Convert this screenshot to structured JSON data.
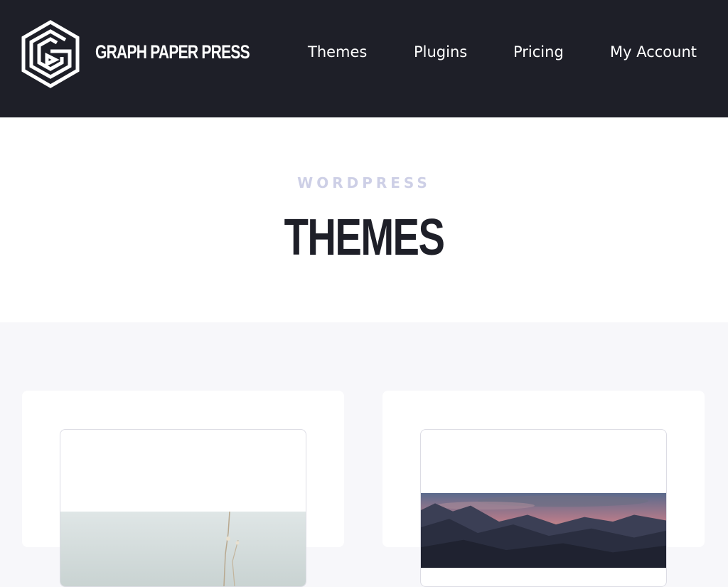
{
  "brand": {
    "name": "GRAPH PAPER PRESS",
    "logo_icon": "hexagon-maze-logo-icon"
  },
  "nav": {
    "items": [
      {
        "label": "Themes"
      },
      {
        "label": "Plugins"
      },
      {
        "label": "Pricing"
      },
      {
        "label": "My Account"
      }
    ]
  },
  "hero": {
    "eyebrow": "WORDPRESS",
    "title": "THEMES"
  },
  "colors": {
    "header_bg": "#1e1f28",
    "eyebrow": "#cdcfe6",
    "title": "#1e1f28",
    "section_bg": "#f7f7fa"
  },
  "cards": [
    {
      "preview_image": "light-landscape-image"
    },
    {
      "preview_image": "mountain-sunset-image"
    }
  ]
}
